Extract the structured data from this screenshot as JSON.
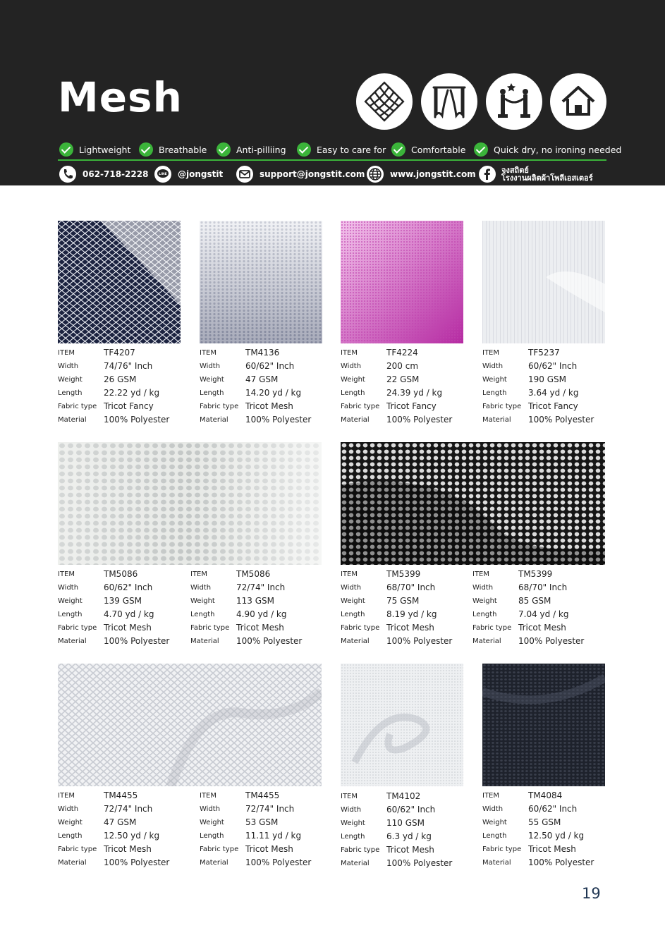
{
  "title": "Mesh",
  "use_icons": [
    "fabric-diamond-icon",
    "curtain-icon",
    "stage-barrier-icon",
    "home-icon"
  ],
  "features": [
    "Lightweight",
    "Breathable",
    "Anti-pilliing",
    "Easy to care for",
    "Comfortable",
    "Quick dry, no ironing needed"
  ],
  "contacts": {
    "phone": "062-718-2228",
    "line": "@jongstit",
    "email": "support@jongstit.com",
    "web": "www.jongstit.com",
    "facebook_line1": "จงสถิตย์",
    "facebook_line2": "โรงงานผลิตผ้าโพลีเอสเตอร์"
  },
  "spec_labels": {
    "item": "ITEM",
    "width": "Width",
    "weight": "Weight",
    "length": "Length",
    "fabric_type": "Fabric type",
    "material": "Material"
  },
  "products": [
    {
      "item": "TF4207",
      "width": "74/76\" Inch",
      "weight": "26 GSM",
      "length": "22.22 yd / kg",
      "fabric_type": "Tricot Fancy",
      "material": "100% Polyester"
    },
    {
      "item": "TM4136",
      "width": "60/62\" Inch",
      "weight": "47 GSM",
      "length": "14.20 yd / kg",
      "fabric_type": "Tricot Mesh",
      "material": "100% Polyester"
    },
    {
      "item": "TF4224",
      "width": "200 cm",
      "weight": "22 GSM",
      "length": "24.39 yd / kg",
      "fabric_type": "Tricot Fancy",
      "material": "100% Polyester"
    },
    {
      "item": "TF5237",
      "width": "60/62\" Inch",
      "weight": "190 GSM",
      "length": "3.64 yd / kg",
      "fabric_type": "Tricot Fancy",
      "material": "100% Polyester"
    },
    {
      "item": "TM5086",
      "width": "60/62\" Inch",
      "weight": "139 GSM",
      "length": "4.70 yd / kg",
      "fabric_type": "Tricot Mesh",
      "material": "100% Polyester"
    },
    {
      "item": "TM5086",
      "width": "72/74\" Inch",
      "weight": "113 GSM",
      "length": "4.90 yd / kg",
      "fabric_type": "Tricot Mesh",
      "material": "100% Polyester"
    },
    {
      "item": "TM5399",
      "width": "68/70\" Inch",
      "weight": "75 GSM",
      "length": "8.19 yd / kg",
      "fabric_type": "Tricot Mesh",
      "material": "100% Polyester"
    },
    {
      "item": "TM5399",
      "width": "68/70\" Inch",
      "weight": "85 GSM",
      "length": "7.04 yd / kg",
      "fabric_type": "Tricot Mesh",
      "material": "100% Polyester"
    },
    {
      "item": "TM4455",
      "width": "72/74\" Inch",
      "weight": "47 GSM",
      "length": "12.50 yd / kg",
      "fabric_type": "Tricot Mesh",
      "material": "100% Polyester"
    },
    {
      "item": "TM4455",
      "width": "72/74\" Inch",
      "weight": "53 GSM",
      "length": "11.11 yd / kg",
      "fabric_type": "Tricot Mesh",
      "material": "100% Polyester"
    },
    {
      "item": "TM4102",
      "width": "60/62\" Inch",
      "weight": "110 GSM",
      "length": "6.3 yd / kg",
      "fabric_type": "Tricot Mesh",
      "material": "100% Polyester"
    },
    {
      "item": "TM4084",
      "width": "60/62\" Inch",
      "weight": "55 GSM",
      "length": "12.50 yd / kg",
      "fabric_type": "Tricot Mesh",
      "material": "100% Polyester"
    }
  ],
  "page_number": "19"
}
